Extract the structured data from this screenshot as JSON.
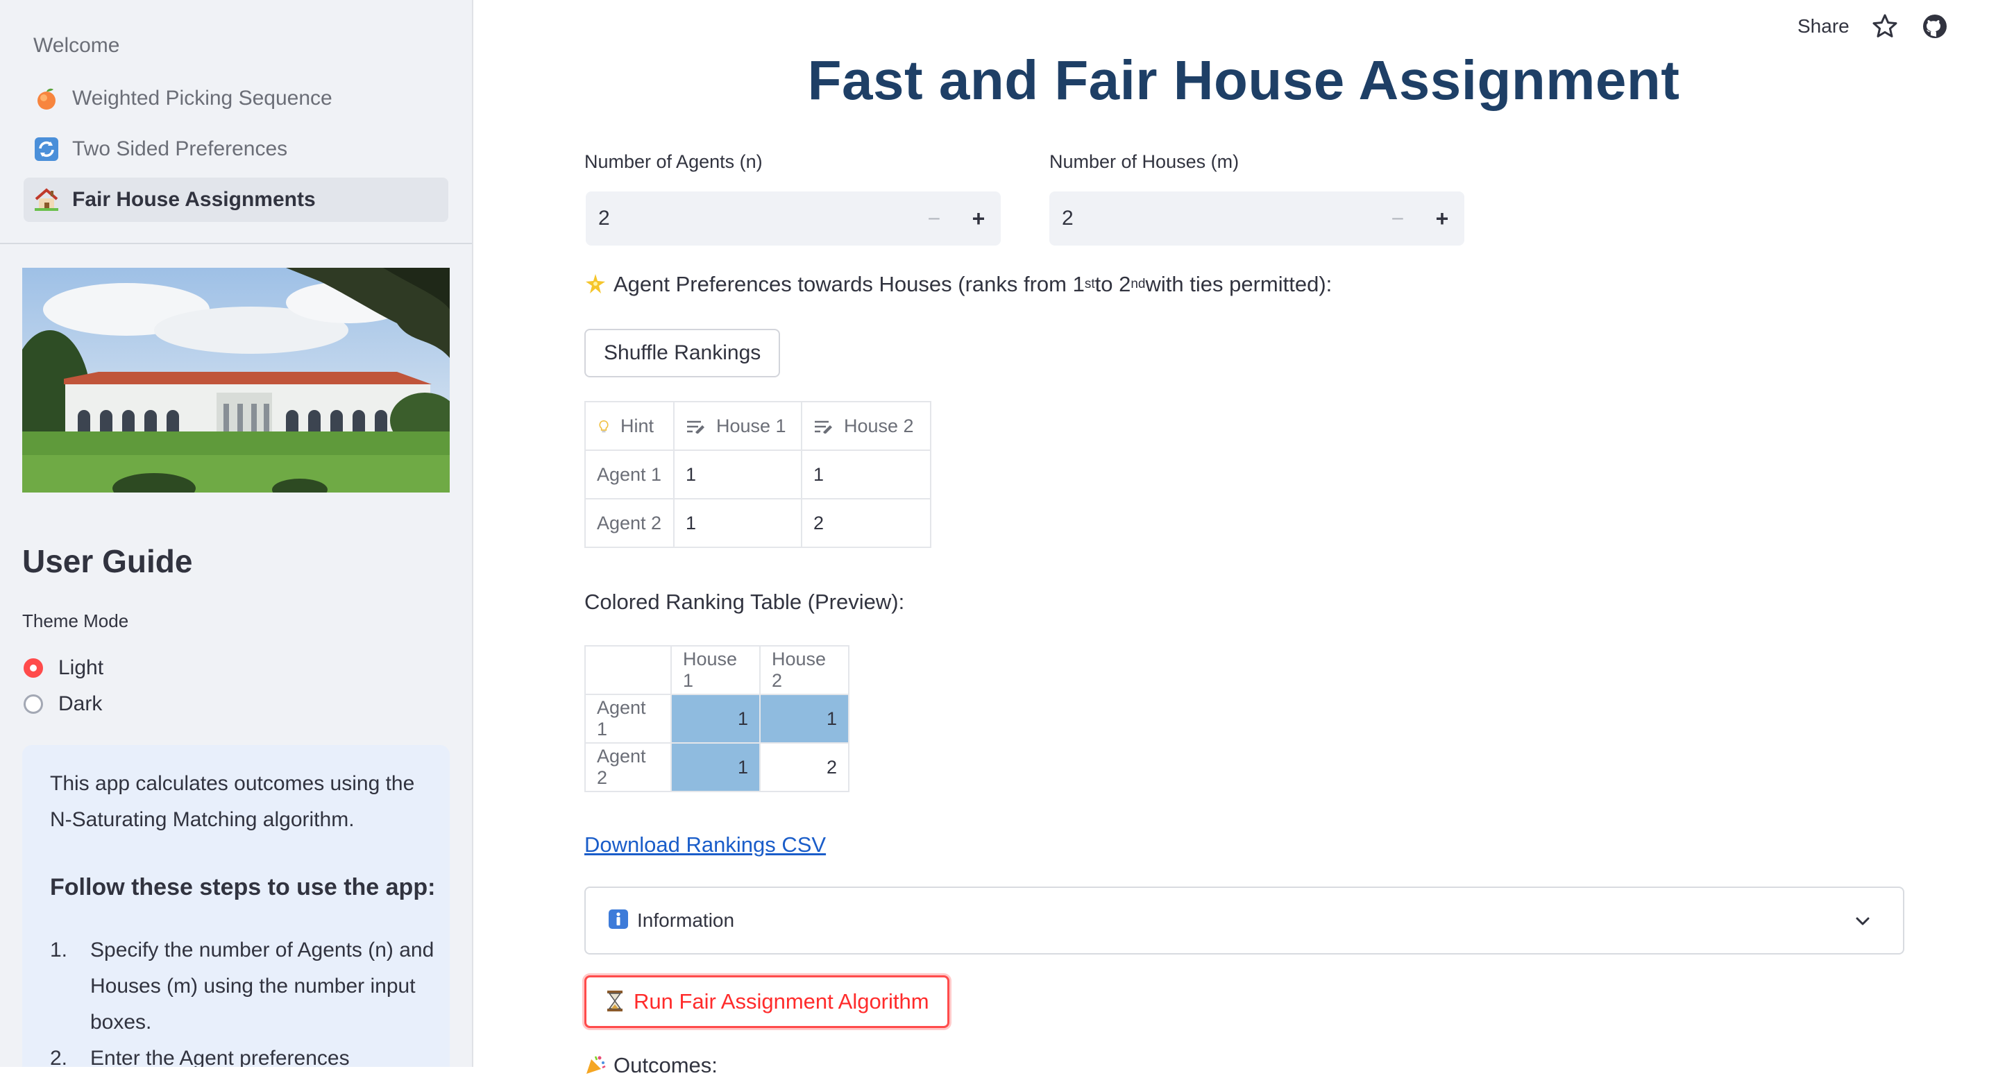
{
  "sidebar": {
    "nav": [
      {
        "label": "Welcome",
        "icon": "none"
      },
      {
        "label": "Weighted Picking Sequence",
        "icon": "peach-icon"
      },
      {
        "label": "Two Sided Preferences",
        "icon": "refresh-icon"
      },
      {
        "label": "Fair House Assignments",
        "icon": "house-icon"
      }
    ],
    "user_guide_heading": "User Guide",
    "theme_label": "Theme Mode",
    "theme_options": [
      "Light",
      "Dark"
    ],
    "theme_selected": "Light",
    "guide": {
      "intro": "This app calculates outcomes using the N-Saturating Matching algorithm.",
      "steps_heading": "Follow these steps to use the app:",
      "steps": [
        {
          "num": "1.",
          "text": "Specify the number of Agents (n) and Houses (m) using the number input boxes."
        },
        {
          "num": "2.",
          "text": "Enter the Agent preferences"
        }
      ]
    }
  },
  "header": {
    "share_label": "Share",
    "accent": "#ff4b4b"
  },
  "main": {
    "title": "Fast and Fair House Assignment",
    "agents_label": "Number of Agents (n)",
    "agents_value": "2",
    "houses_label": "Number of Houses (m)",
    "houses_value": "2",
    "minus": "−",
    "plus": "+",
    "pref_text_a": "Agent Preferences towards Houses (ranks from 1",
    "pref_sup_a": "st",
    "pref_text_b": " to 2",
    "pref_sup_b": "nd",
    "pref_text_c": " with ties permitted):",
    "shuffle_label": "Shuffle Rankings",
    "editor": {
      "headers": [
        "Hint",
        "House 1",
        "House 2"
      ],
      "rows": [
        [
          "Agent 1",
          "1",
          "1"
        ],
        [
          "Agent 2",
          "1",
          "2"
        ]
      ]
    },
    "preview_label": "Colored Ranking Table (Preview):",
    "preview": {
      "headers": [
        "",
        "House 1",
        "House 2"
      ],
      "rows": [
        [
          "Agent 1",
          "1",
          "1"
        ],
        [
          "Agent 2",
          "1",
          "2"
        ]
      ],
      "highlight_color": "#8fbbdf"
    },
    "download_label": "Download Rankings CSV",
    "expander_label": "Information",
    "run_label": "Run Fair Assignment Algorithm",
    "outcomes_label": "Outcomes:"
  }
}
